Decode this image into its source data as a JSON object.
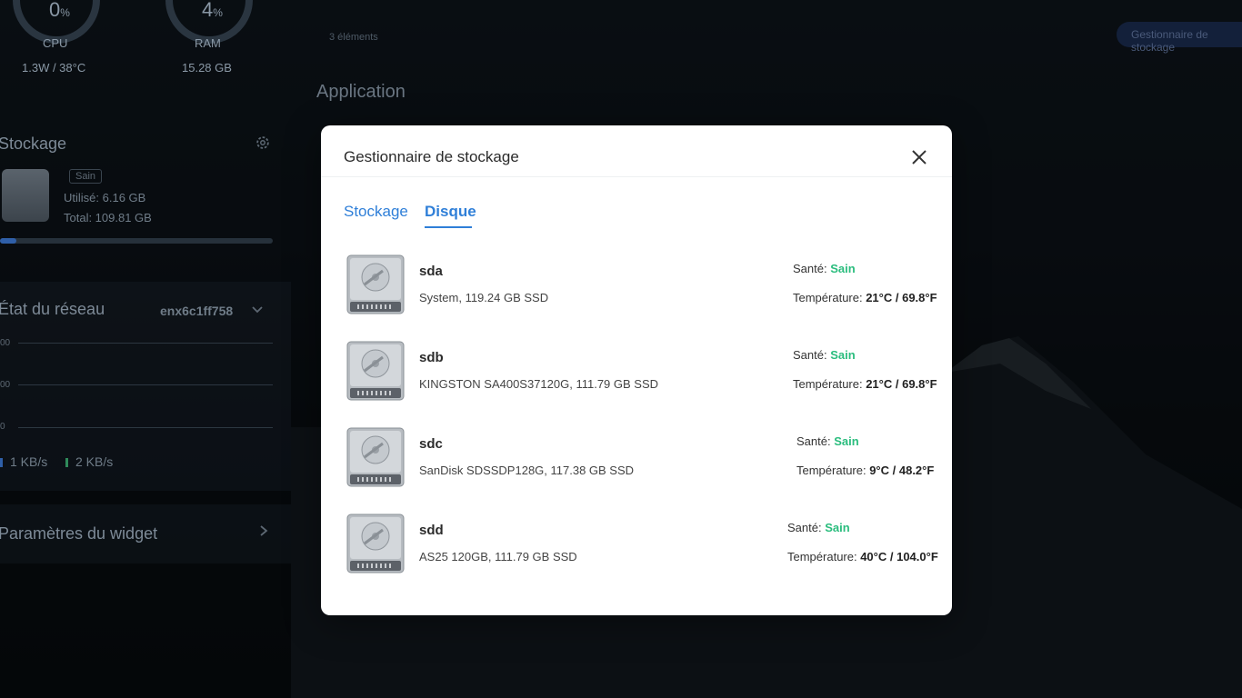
{
  "colors": {
    "accent": "#2f7fd8",
    "healthy": "#2bbd7e",
    "modal_bg": "#ffffff",
    "backdrop": "#0c1218"
  },
  "background": {
    "cpu": {
      "value": "0",
      "unit": "%",
      "label": "CPU",
      "sub": "1.3W / 38°C"
    },
    "ram": {
      "value": "4",
      "unit": "%",
      "label": "RAM",
      "sub": "15.28 GB"
    },
    "storage": {
      "title": "Stockage",
      "status": "Sain",
      "used": "Utilisé: 6.16 GB",
      "total": "Total: 109.81 GB",
      "used_fraction": 0.06
    },
    "network": {
      "title": "État du réseau",
      "interface": "enx6c1ff758",
      "axis": [
        "00",
        "00",
        "0"
      ],
      "upload": "1 KB/s",
      "download": "2 KB/s"
    },
    "widget_settings": "Paramètres du widget",
    "items_count": "3 éléments",
    "manager_button": "Gestionnaire de stockage",
    "app_section": "Application"
  },
  "modal": {
    "title": "Gestionnaire de stockage",
    "tabs": [
      {
        "label": "Stockage",
        "active": false
      },
      {
        "label": "Disque",
        "active": true
      }
    ],
    "health_label": "Santé: ",
    "temp_label": "Température: ",
    "disks": [
      {
        "name": "sda",
        "description": "System, 119.24 GB SSD",
        "health": "Sain",
        "temperature": "21°C / 69.8°F"
      },
      {
        "name": "sdb",
        "description": "KINGSTON SA400S37120G, 111.79 GB SSD",
        "health": "Sain",
        "temperature": "21°C / 69.8°F"
      },
      {
        "name": "sdc",
        "description": "SanDisk SDSSDP128G, 117.38 GB SSD",
        "health": "Sain",
        "temperature": "9°C / 48.2°F"
      },
      {
        "name": "sdd",
        "description": "AS25 120GB, 111.79 GB SSD",
        "health": "Sain",
        "temperature": "40°C / 104.0°F"
      }
    ]
  }
}
